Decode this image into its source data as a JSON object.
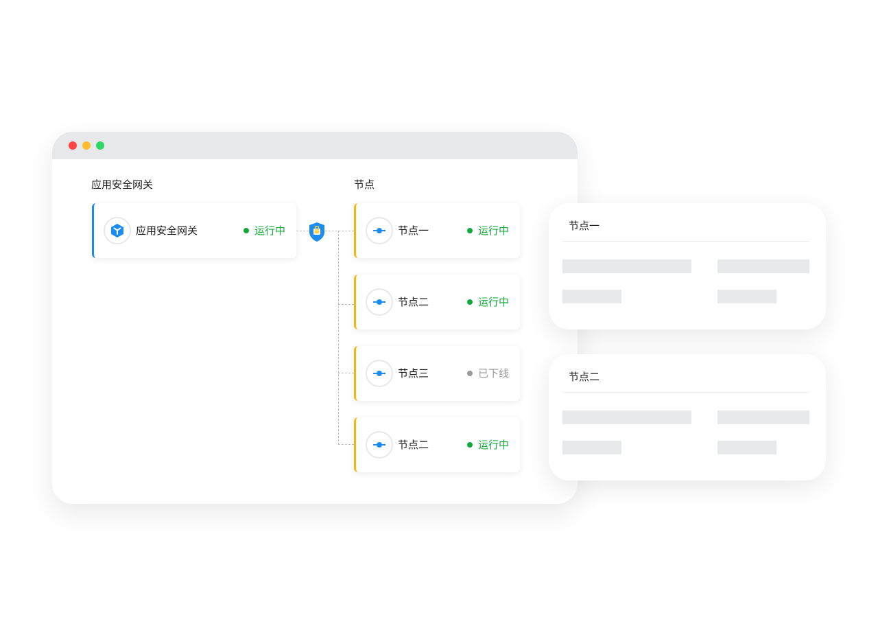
{
  "window": {
    "dots": [
      "close",
      "minimize",
      "maximize"
    ],
    "gateway_section_title": "应用安全网关",
    "nodes_section_title": "节点"
  },
  "gateway": {
    "icon": "cube-icon",
    "label": "应用安全网关",
    "status": "运行中"
  },
  "connector_icon": "shield-icon",
  "nodes": [
    {
      "label": "节点一",
      "status": "运行中",
      "state": "running"
    },
    {
      "label": "节点二",
      "status": "运行中",
      "state": "running"
    },
    {
      "label": "节点三",
      "status": "已下线",
      "state": "offline"
    },
    {
      "label": "节点二",
      "status": "运行中",
      "state": "running"
    }
  ],
  "panels": [
    {
      "title": "节点一"
    },
    {
      "title": "节点二"
    }
  ],
  "colors": {
    "accent_blue": "#1c8cf0",
    "node_border": "#f2b712",
    "running": "#13aa3b",
    "offline": "#9a9a9a"
  }
}
